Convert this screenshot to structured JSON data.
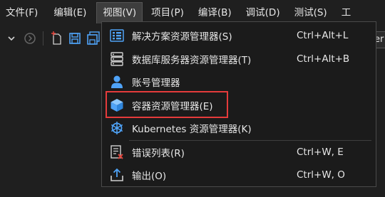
{
  "menubar": {
    "items": [
      {
        "label": "文件(F)"
      },
      {
        "label": "编辑(E)"
      },
      {
        "label": "视图(V)"
      },
      {
        "label": "项目(P)"
      },
      {
        "label": "编译(B)"
      },
      {
        "label": "调试(D)"
      },
      {
        "label": "测试(S)"
      },
      {
        "label": "工"
      }
    ],
    "active_index": 2
  },
  "toolbar": {
    "right_field_value": "er"
  },
  "view_menu": {
    "items": [
      {
        "label": "解决方案资源管理器(S)",
        "shortcut": "Ctrl+Alt+L",
        "icon": "solution-explorer-icon"
      },
      {
        "label": "数据库服务器资源管理器(T)",
        "shortcut": "Ctrl+Alt+B",
        "icon": "server-explorer-icon"
      },
      {
        "label": "账号管理器",
        "shortcut": "",
        "icon": "account-icon"
      },
      {
        "label": "容器资源管理器(E)",
        "shortcut": "",
        "icon": "container-icon"
      },
      {
        "label": "Kubernetes 资源管理器(K)",
        "shortcut": "",
        "icon": "kubernetes-icon"
      },
      {
        "label": "错误列表(R)",
        "shortcut": "Ctrl+W, E",
        "icon": "error-list-icon"
      },
      {
        "label": "输出(O)",
        "shortcut": "Ctrl+W, O",
        "icon": "output-icon"
      }
    ],
    "highlighted_item": "容器资源管理器(E)",
    "highlight_color": "#e53b3b",
    "accent_color": "#4fa3f7"
  }
}
